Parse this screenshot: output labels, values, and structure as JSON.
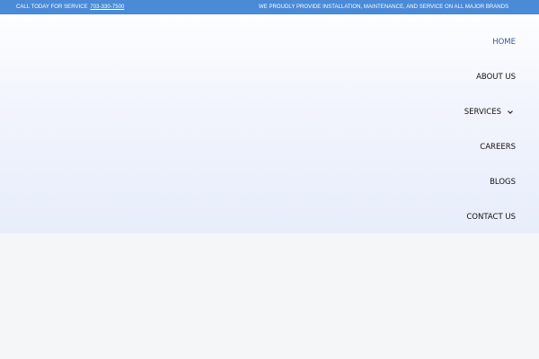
{
  "topbar": {
    "call_text": "CALL TODAY FOR SERVICE",
    "phone": "703-330-7500",
    "tagline": "WE PROUDLY PROVIDE INSTALLATION, MAINTENANCE, AND SERVICE ON ALL MAJOR BRANDS"
  },
  "nav": {
    "items": [
      {
        "label": "HOME"
      },
      {
        "label": "ABOUT US"
      },
      {
        "label": "SERVICES"
      },
      {
        "label": "CAREERS"
      },
      {
        "label": "BLOGS"
      },
      {
        "label": "CONTACT US"
      }
    ]
  },
  "colors": {
    "topbar_bg": "#4a8ad6",
    "nav_active": "#3a5a8f",
    "nav_text": "#111111"
  },
  "icons": {
    "services_dropdown": "chevron-down-icon"
  }
}
